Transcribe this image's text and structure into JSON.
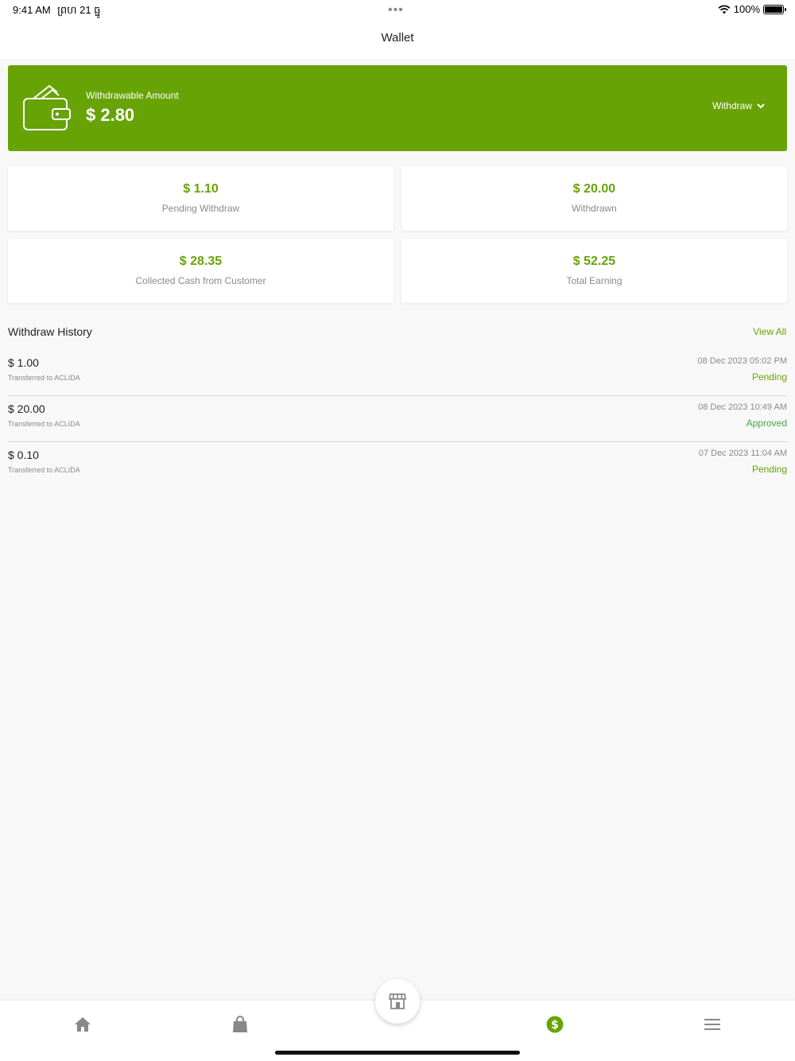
{
  "status_bar": {
    "time": "9:41 AM",
    "date": "ព្រហ 21 ធ្នូ",
    "battery": "100%"
  },
  "header": {
    "title": "Wallet"
  },
  "hero": {
    "label": "Withdrawable Amount",
    "amount": "$ 2.80",
    "withdraw_label": "Withdraw"
  },
  "stats": [
    {
      "value": "$ 1.10",
      "caption": "Pending Withdraw"
    },
    {
      "value": "$ 20.00",
      "caption": "Withdrawn"
    },
    {
      "value": "$ 28.35",
      "caption": "Collected Cash from Customer"
    },
    {
      "value": "$ 52.25",
      "caption": "Total Earning"
    }
  ],
  "history": {
    "title": "Withdraw History",
    "view_all": "View All",
    "items": [
      {
        "amount": "$ 1.00",
        "desc": "Transferred to ACLIDA",
        "date": "08 Dec 2023  05:02 PM",
        "status": "Pending"
      },
      {
        "amount": "$ 20.00",
        "desc": "Transferred to ACLIDA",
        "date": "08 Dec 2023  10:49 AM",
        "status": "Approved"
      },
      {
        "amount": "$ 0.10",
        "desc": "Transferred to ACLIDA",
        "date": "07 Dec 2023  11:04 AM",
        "status": "Pending"
      }
    ]
  },
  "tabbar": {
    "icons": [
      "home-icon",
      "shopping-bag-icon",
      "store-icon",
      "dollar-icon",
      "menu-icon"
    ],
    "active": "dollar-icon",
    "active_color": "#68a306",
    "inactive_color": "#888888"
  },
  "colors": {
    "brand": "#68a306",
    "approved": "#3fa94a"
  }
}
